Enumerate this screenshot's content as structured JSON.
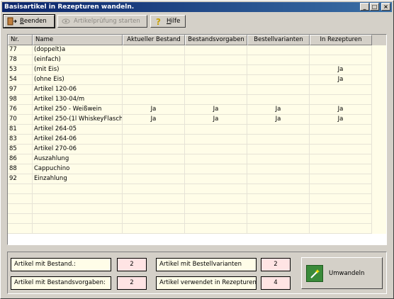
{
  "window": {
    "title": "Basisartikel in Rezepturen wandeln."
  },
  "toolbar": {
    "beenden": "Beenden",
    "artikelpruefung": "Artikelprüfung starten",
    "hilfe": "Hilfe"
  },
  "table": {
    "columns": [
      "Nr.",
      "Name",
      "Aktueller Bestand",
      "Bestandsvorgaben",
      "Bestellvarianten",
      "In Rezepturen"
    ],
    "rows": [
      [
        "77",
        "(doppelt)a",
        "",
        "",
        "",
        ""
      ],
      [
        "78",
        "(einfach)",
        "",
        "",
        "",
        ""
      ],
      [
        "53",
        "(mit Eis)",
        "",
        "",
        "",
        "Ja"
      ],
      [
        "54",
        "(ohne Eis)",
        "",
        "",
        "",
        "Ja"
      ],
      [
        "97",
        "Artikel 120-06",
        "",
        "",
        "",
        ""
      ],
      [
        "98",
        "Artikel 130-04/m",
        "",
        "",
        "",
        ""
      ],
      [
        "76",
        "Artikel 250 - Weißwein",
        "Ja",
        "Ja",
        "Ja",
        "Ja"
      ],
      [
        "70",
        "Artikel 250-(1l WhiskeyFlasch",
        "Ja",
        "Ja",
        "Ja",
        "Ja"
      ],
      [
        "81",
        "Artikel 264-05",
        "",
        "",
        "",
        ""
      ],
      [
        "83",
        "Artikel 264-06",
        "",
        "",
        "",
        ""
      ],
      [
        "85",
        "Artikel 270-06",
        "",
        "",
        "",
        ""
      ],
      [
        "86",
        "Auszahlung",
        "",
        "",
        "",
        ""
      ],
      [
        "88",
        "Cappuchino",
        "",
        "",
        "",
        ""
      ],
      [
        "92",
        "Einzahlung",
        "",
        "",
        "",
        ""
      ]
    ]
  },
  "summary": {
    "bestand_label": "Artikel mit Bestand.:",
    "bestand_value": "2",
    "vorgaben_label": "Artikel mit Bestandsvorgaben:",
    "vorgaben_value": "2",
    "bestellvarianten_label": "Artikel mit Bestellvarianten",
    "bestellvarianten_value": "2",
    "rezepturen_label": "Artikel verwendet in Rezepturen",
    "rezepturen_value": "4"
  },
  "umwandeln": {
    "label": "Umwandeln"
  }
}
